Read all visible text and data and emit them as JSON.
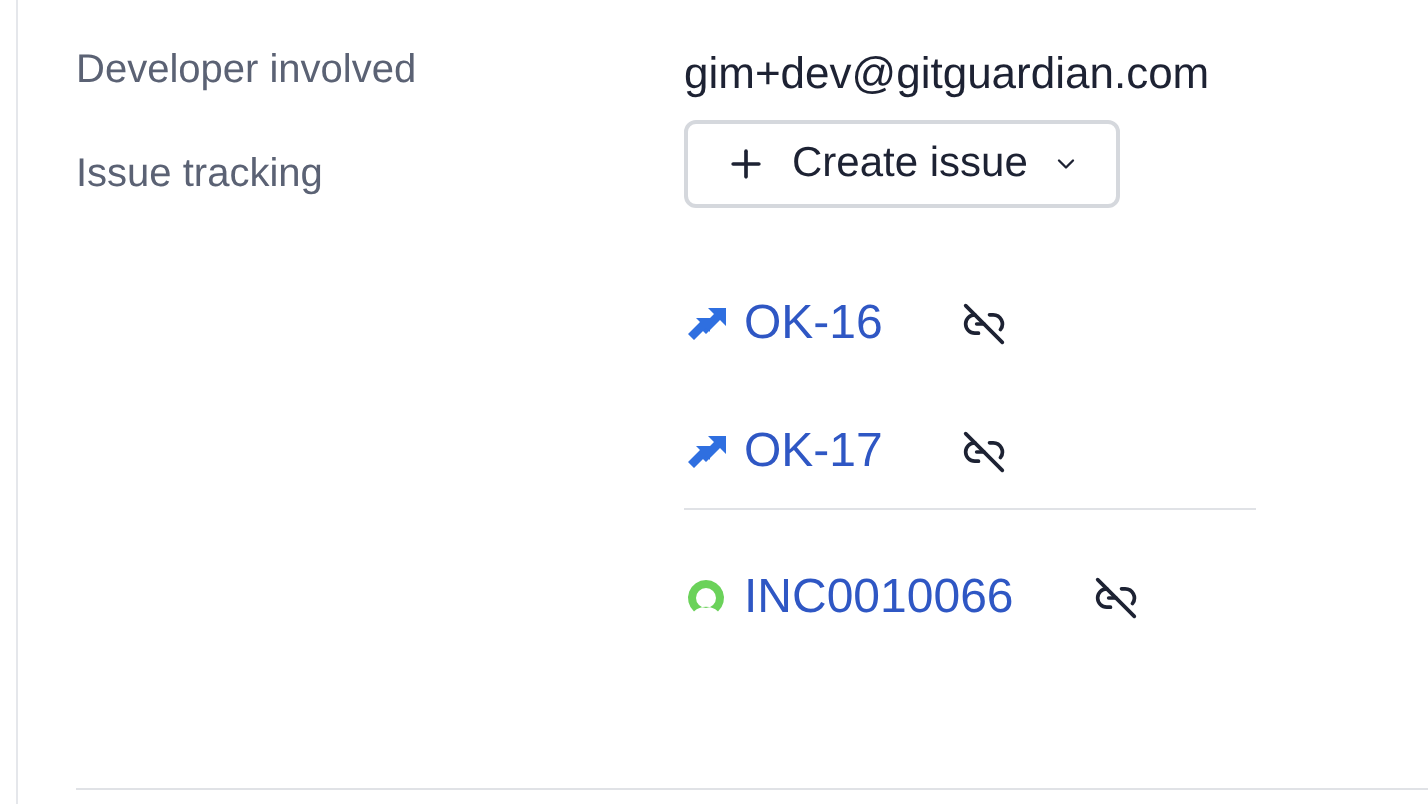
{
  "fields": [
    {
      "label": "Developer involved",
      "value": "gim+dev@gitguardian.com"
    }
  ],
  "issue_tracking": {
    "label": "Issue tracking",
    "button": "Create issue",
    "groups": [
      {
        "kind": "jira",
        "issues": [
          {
            "id": "OK-16"
          },
          {
            "id": "OK-17"
          }
        ]
      },
      {
        "kind": "servicenow",
        "issues": [
          {
            "id": "INC0010066"
          }
        ]
      }
    ]
  }
}
